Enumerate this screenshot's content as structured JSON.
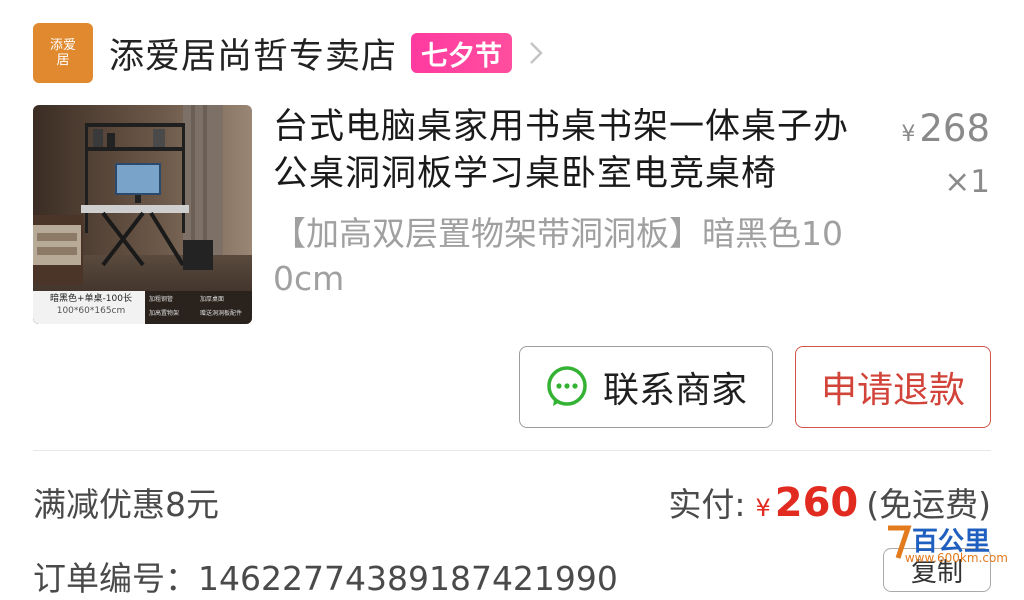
{
  "store": {
    "logo_text_top": "添爱",
    "logo_text_bottom": "居",
    "name": "添爱居尚哲专卖店",
    "promo_badge": "七夕节"
  },
  "product": {
    "title": "台式电脑桌家用书桌书架一体桌子办公桌洞洞板学习桌卧室电竞桌椅",
    "spec": "【加高双层置物架带洞洞板】暗黑色100cm",
    "price_symbol": "¥",
    "price": "268",
    "quantity": "×1",
    "image": {
      "caption_main": "暗黑色+单桌-100长",
      "caption_size": "100*60*165cm",
      "features": [
        "加粗钢管",
        "加厚桌面",
        "加高置物架",
        "赠送洞洞板配件"
      ]
    }
  },
  "actions": {
    "contact_label": "联系商家",
    "refund_label": "申请退款"
  },
  "summary": {
    "discount_text": "满减优惠8元",
    "paid_label": "实付:",
    "paid_symbol": "¥",
    "paid_amount": "260",
    "shipping_note": "(免运费)"
  },
  "order": {
    "number_label": "订单编号：",
    "number_value": "14622774389187421990",
    "copy_label": "复制"
  },
  "watermark": {
    "brand": "百公里",
    "url": "www.600km.com"
  },
  "colors": {
    "accent_red": "#e22b20",
    "badge_pink": "#ff3aa0",
    "logo_orange": "#e0892f",
    "wechat_green": "#34b233"
  }
}
